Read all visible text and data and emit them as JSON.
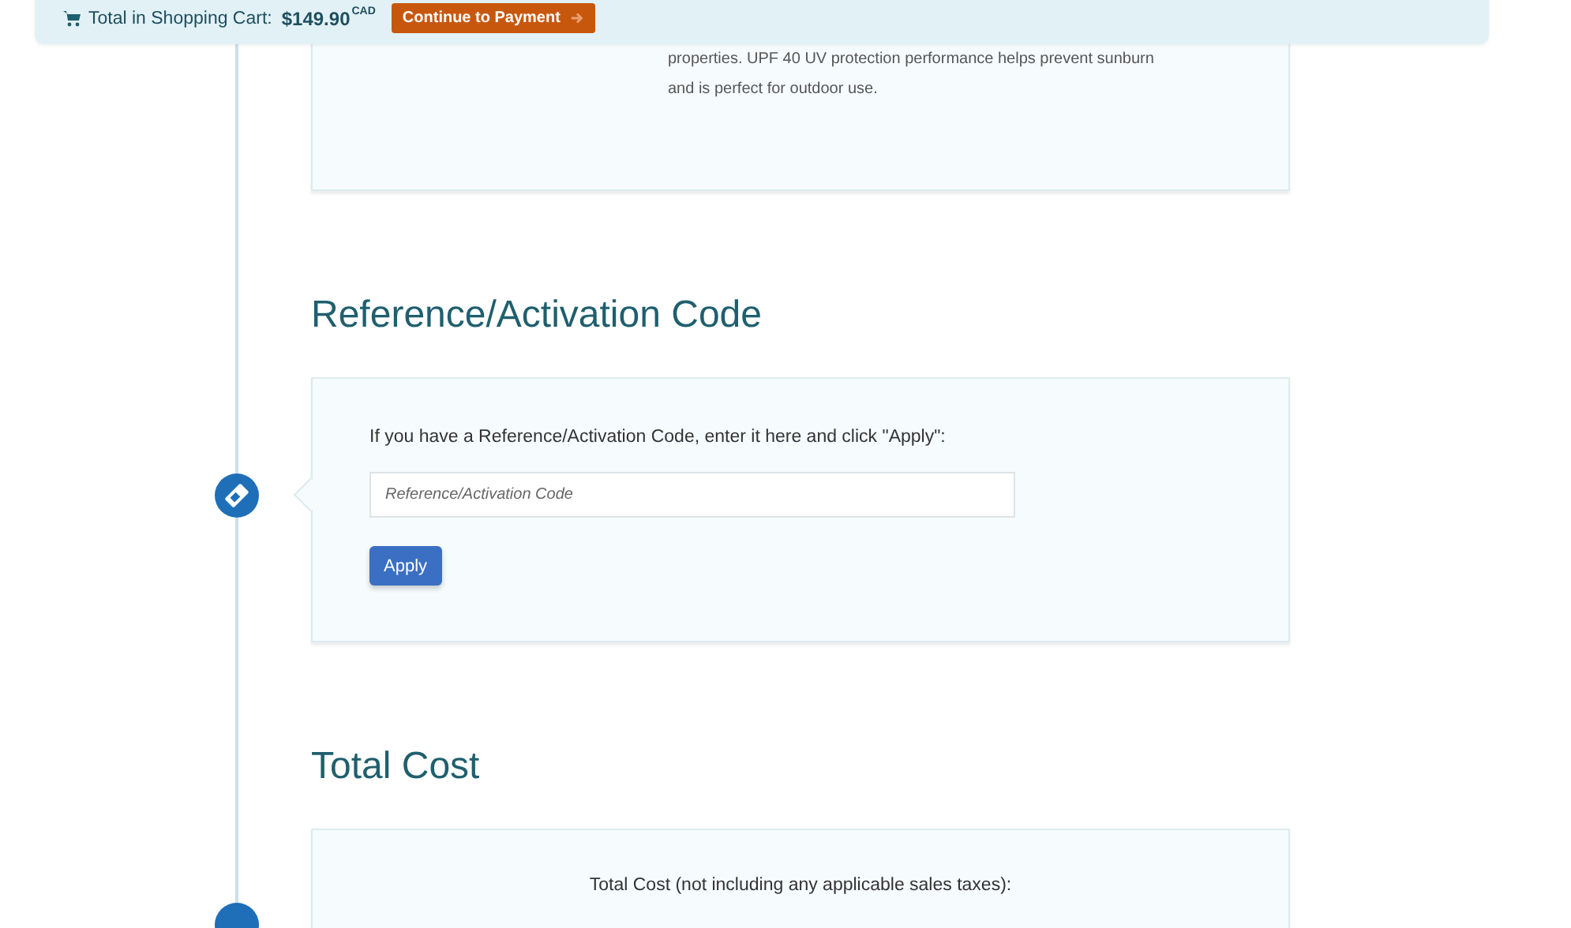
{
  "cart_bar": {
    "label": "Total in Shopping Cart:",
    "amount": "$149.90",
    "currency": "CAD",
    "button": "Continue to Payment"
  },
  "product_card": {
    "description_lines": [
      "properties. UPF 40 UV protection performance helps prevent sunburn",
      "and is perfect for outdoor use."
    ]
  },
  "sections": [
    {
      "kind": "code",
      "title": "Reference/Activation Code",
      "instruction": "If you have a Reference/Activation Code, enter it here and click \"Apply\":",
      "placeholder": "Reference/Activation Code",
      "button": "Apply"
    },
    {
      "kind": "total",
      "title": "Total Cost",
      "instruction": "Total Cost (not including any applicable sales taxes):"
    }
  ]
}
